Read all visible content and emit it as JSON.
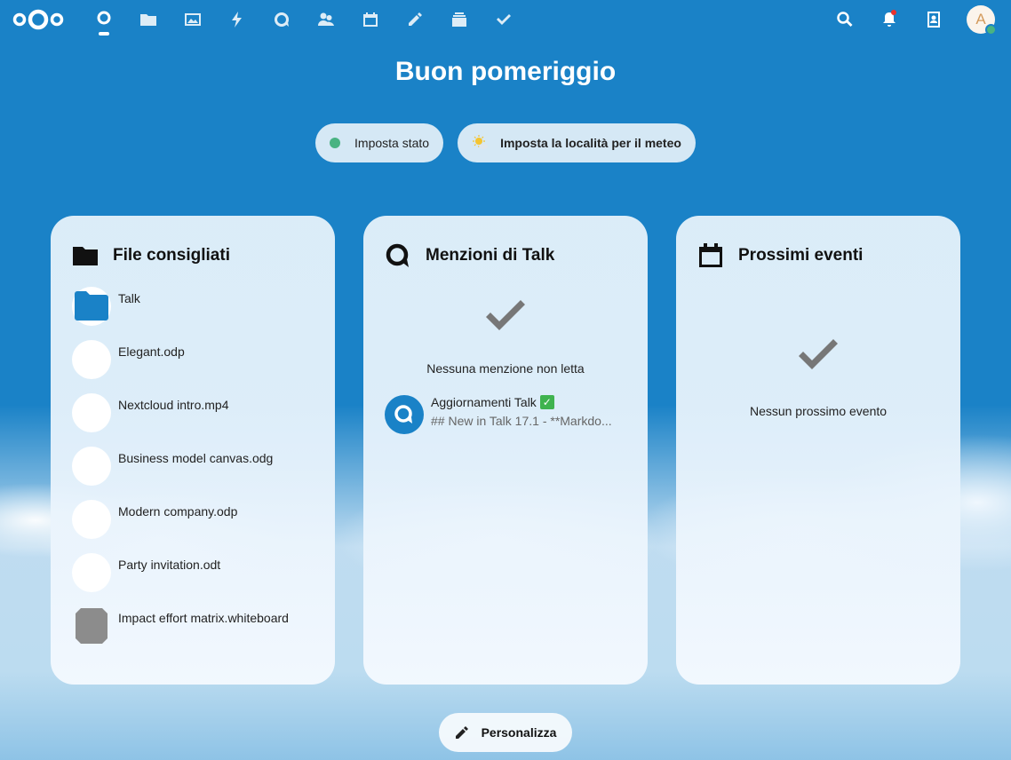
{
  "header": {
    "apps": [
      {
        "name": "dashboard",
        "icon": "dashboard-icon",
        "active": true
      },
      {
        "name": "files",
        "icon": "folder-icon"
      },
      {
        "name": "photos",
        "icon": "image-icon"
      },
      {
        "name": "activity",
        "icon": "lightning-icon"
      },
      {
        "name": "talk",
        "icon": "talk-icon"
      },
      {
        "name": "contacts",
        "icon": "contacts-icon"
      },
      {
        "name": "calendar",
        "icon": "calendar-icon"
      },
      {
        "name": "notes",
        "icon": "pencil-icon"
      },
      {
        "name": "deck",
        "icon": "deck-icon"
      },
      {
        "name": "tasks",
        "icon": "checkmark-icon"
      }
    ],
    "avatar_initial": "A"
  },
  "greeting": "Buon pomeriggio",
  "status": {
    "set_status_label": "Imposta stato",
    "weather_label": "Imposta la località per il meteo"
  },
  "panels": {
    "files": {
      "title": "File consigliati",
      "items": [
        {
          "name": "Talk",
          "icon": "folder-icon"
        },
        {
          "name": "Elegant.odp",
          "icon": "file-icon"
        },
        {
          "name": "Nextcloud intro.mp4",
          "icon": "file-icon"
        },
        {
          "name": "Business model canvas.odg",
          "icon": "file-icon"
        },
        {
          "name": "Modern company.odp",
          "icon": "file-icon"
        },
        {
          "name": "Party invitation.odt",
          "icon": "file-icon"
        },
        {
          "name": "Impact effort matrix.whiteboard",
          "icon": "whiteboard-icon"
        }
      ]
    },
    "talk": {
      "title": "Menzioni di Talk",
      "empty_text": "Nessuna menzione non letta",
      "conversation": {
        "title": "Aggiornamenti Talk",
        "preview": "## New in Talk 17.1 - **Markdo..."
      }
    },
    "events": {
      "title": "Prossimi eventi",
      "empty_text": "Nessun prossimo evento"
    }
  },
  "customize_label": "Personalizza",
  "colors": {
    "background": "#1a82c7",
    "status_online": "#49b382",
    "notification": "#e9322d"
  }
}
